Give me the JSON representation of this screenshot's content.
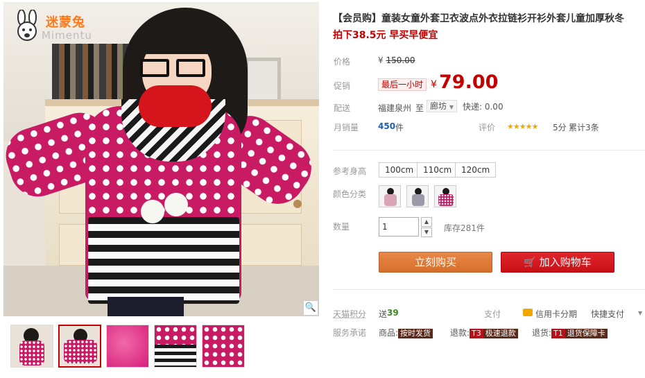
{
  "brand": {
    "name": "迷蒙兔",
    "subname": "Mimentu"
  },
  "product": {
    "title": "【会员购】童装女童外套卫衣波点外衣拉链衫开衫外套儿童加厚秋冬",
    "subtitle": "拍下38.5元 早买早便宜"
  },
  "price": {
    "label": "价格",
    "currency": "¥",
    "original": "150.00",
    "promo_label": "促销",
    "promo_tag": "最后一小时",
    "promo_currency": "¥",
    "promo_value": "79.00"
  },
  "shipping": {
    "label": "配送",
    "origin": "福建泉州",
    "to": "至",
    "destination": "廊坊",
    "fee": "快递: 0.00"
  },
  "sales": {
    "label": "月销量",
    "count": "450",
    "unit": "件",
    "rating_label": "评价",
    "stars": "★★★★★",
    "score": "5分",
    "reviews": "累计3条"
  },
  "options": {
    "size_label": "参考身高",
    "sizes": [
      "100cm",
      "110cm",
      "120cm"
    ],
    "color_label": "颜色分类"
  },
  "quantity": {
    "label": "数量",
    "value": "1",
    "up": "▲",
    "down": "▼",
    "stock": "库存281件"
  },
  "actions": {
    "buy": "立刻购买",
    "cart": "加入购物车",
    "cart_icon": "🛒"
  },
  "points": {
    "label": "天猫积分",
    "value_prefix": "送",
    "value": "39",
    "pay_label": "支付",
    "credit": "信用卡分期",
    "quick": "快捷支付",
    "more": "▾"
  },
  "service": {
    "label": "服务承诺",
    "goods_label": "商品:",
    "goods_badge": "按时发货",
    "refund_label": "退款:",
    "refund_code": "T3",
    "refund_badge": "极速退款",
    "return_label": "退货:",
    "return_code": "T1",
    "return_badge": "退货保障卡"
  },
  "icons": {
    "zoom": "🔍"
  }
}
